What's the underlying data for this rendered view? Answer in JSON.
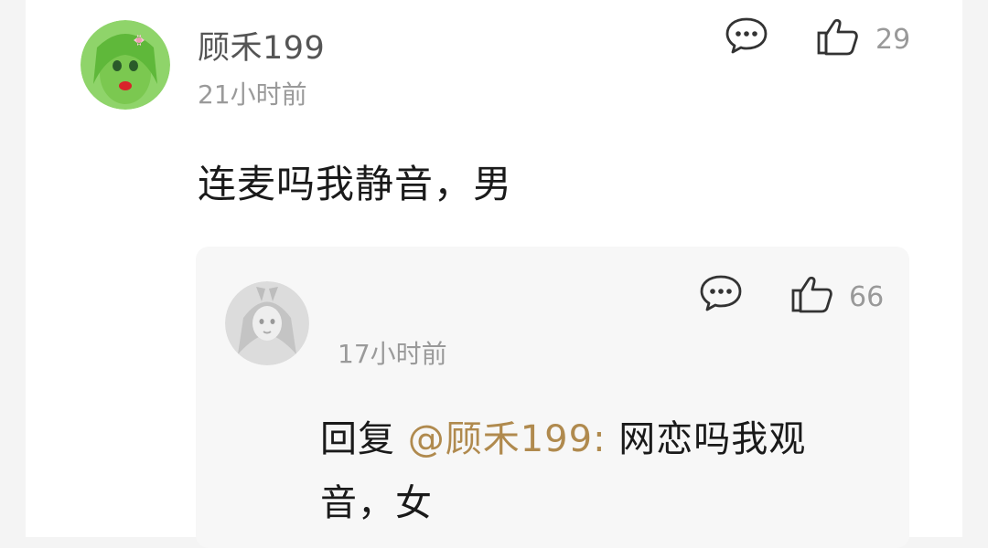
{
  "comment": {
    "username": "顾禾199",
    "time": "21小时前",
    "text": "连麦吗我静音，男",
    "like_count": "29"
  },
  "reply": {
    "time": "17小时前",
    "prefix": "回复 ",
    "mention": "@顾禾199:",
    "text": " 网恋吗我观音，女",
    "like_count": "66"
  },
  "icons": {
    "reply": "speech-bubble-icon",
    "like": "thumbs-up-icon"
  },
  "colors": {
    "mention": "#b08a4e",
    "reply_background": "#f7f7f7"
  }
}
